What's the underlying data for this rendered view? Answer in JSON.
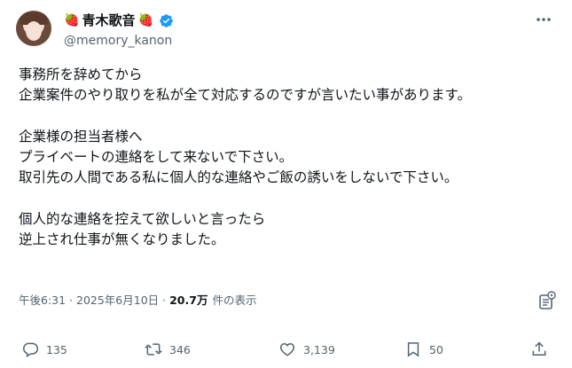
{
  "author": {
    "display_name": "青木歌音",
    "name_emoji": "🍓",
    "handle": "@memory_kanon",
    "verified_color": "#1d9bf0"
  },
  "post": {
    "text": "事務所を辞めてから\n企業案件のやり取りを私が全て対応するのですが言いたい事があります。\n\n企業様の担当者様へ\nプライベートの連絡をして来ないで下さい。\n取引先の人間である私に個人的な連絡やご飯の誘いをしないで下さい。\n\n個人的な連絡を控えて欲しいと言ったら\n逆上され仕事が無くなりました。",
    "timestamp": "午後6:31 · 2025年6月10日 · ",
    "views_count": "20.7万",
    "views_label": "件の表示"
  },
  "actions": {
    "replies": "135",
    "reposts": "346",
    "likes": "3,139",
    "bookmarks": "50"
  },
  "icons": [
    "more-icon",
    "grok-icon",
    "reply-icon",
    "repost-icon",
    "like-icon",
    "bookmark-icon",
    "share-icon",
    "verified-badge-icon"
  ]
}
